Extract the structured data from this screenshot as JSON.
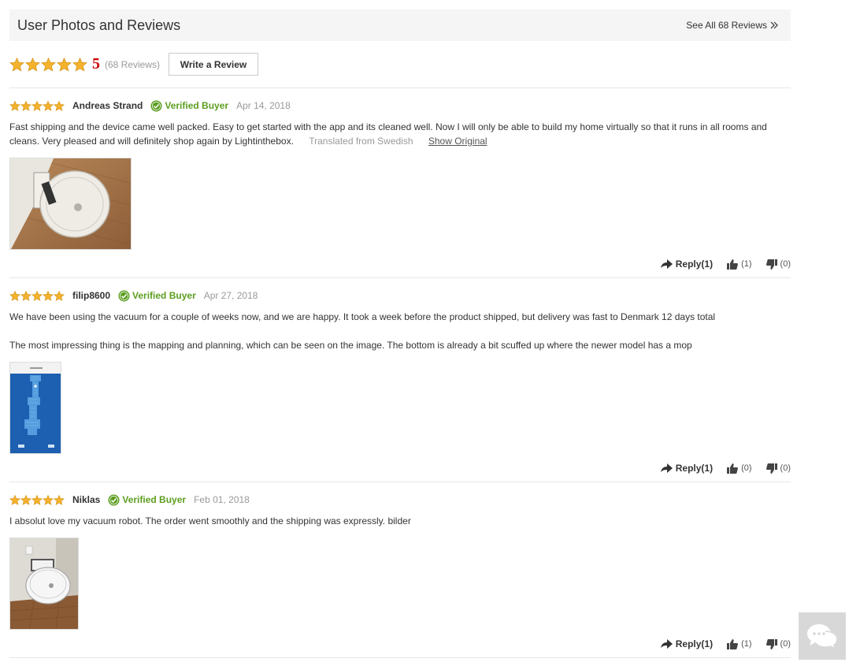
{
  "header": {
    "title": "User Photos and Reviews",
    "see_all_label": "See All 68 Reviews"
  },
  "summary": {
    "score": "5",
    "count": "(68 Reviews)",
    "write_label": "Write a Review",
    "stars": 5
  },
  "colors": {
    "star": "#f5b22d",
    "verified": "#5c9e1e",
    "score": "#cc0000"
  },
  "reviews": [
    {
      "user": "Andreas Strand",
      "verified": "Verified Buyer",
      "date": "Apr 14, 2018",
      "text": "Fast shipping and the device came well packed. Easy to get started with the app and its cleaned well. Now I will only be able to build my home virtually so that it runs in all rooms and cleans. Very pleased and will definitely shop again by Lightinthebox.",
      "translated": "Translated from Swedish",
      "show_original": "Show Original",
      "reply": "Reply(1)",
      "likes": "(1)",
      "dislikes": "(0)"
    },
    {
      "user": "filip8600",
      "verified": "Verified Buyer",
      "date": "Apr 27, 2018",
      "text": "We have been using the vacuum for a couple of weeks now, and we are happy. It took a week before the product shipped, but delivery was fast to Denmark 12 days total",
      "text2": "The most impressing thing is the mapping and planning, which can be seen on the image. The bottom is already a bit scuffed up where the newer model has a mop",
      "reply": "Reply(1)",
      "likes": "(0)",
      "dislikes": "(0)"
    },
    {
      "user": "Niklas",
      "verified": "Verified Buyer",
      "date": "Feb 01, 2018",
      "text": "I absolut love my vacuum robot. The order went smoothly and the shipping was expressly. bilder",
      "reply": "Reply(1)",
      "likes": "(1)",
      "dislikes": "(0)"
    }
  ],
  "icons": {
    "star": "star-icon",
    "verified": "check-circle-icon",
    "reply": "reply-arrow-icon",
    "like": "thumbs-up-icon",
    "dislike": "thumbs-down-icon",
    "chat": "chat-bubble-icon"
  }
}
